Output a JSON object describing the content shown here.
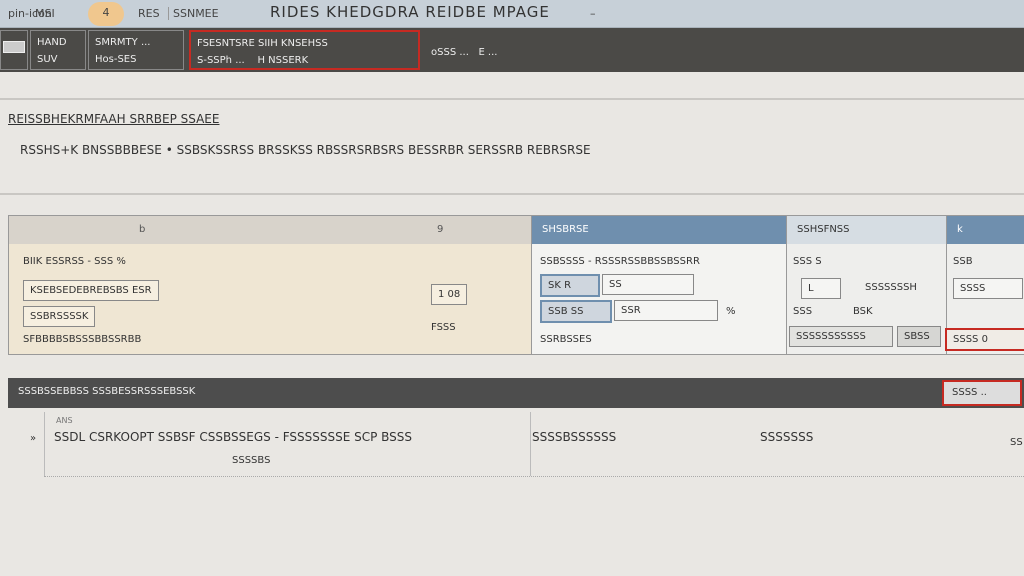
{
  "titlebar": {
    "app_icon": "pin-icon",
    "item1": "MSI",
    "item2": "4",
    "item3": "RES",
    "file": "SSNMEE",
    "title": "RIDES KHEDGDRA REIDBE MPAGE",
    "minimize": "–"
  },
  "toolbar": {
    "g1": [
      "HAND",
      "SUV"
    ],
    "g2": [
      "SMRMTY ...",
      "Hos-SES"
    ],
    "g3": [
      "FSESNTSRE SIIH KNSEHSS",
      "S-SSPh ...",
      "H NSSERK"
    ],
    "g4": [
      "oSSS ...",
      "E ..."
    ]
  },
  "intro": {
    "line1": "REISSBHEKRMFAAH SRRBEP SSAEE",
    "line2": "RSSHS+K BNSSBBBESE • SSBSKSSRSS BRSSKSS RBSSRSRBSRS BESSRBR SERSSRB REBRSRSE"
  },
  "panel": {
    "left": {
      "header_a": "b",
      "header_b": "9",
      "rows": [
        "BIIK ESSRSS - SSS %",
        "KSEBSEDEBREBSBS ESR",
        "SSBRSSSSK",
        "SFBBBBSBSSSBBSSRBB"
      ],
      "value": "1 08",
      "note": "FSSS"
    },
    "mid": {
      "header": "SHSBRSE",
      "row1": "SSBSSSS - RSSSRSSBBSSBSSRR",
      "f1_label": "SK R",
      "f1_value": "SS",
      "f2_label": "SSB SS",
      "f2_value": "SSR",
      "f2_unit": "%",
      "footer": "SSRBSSES"
    },
    "right1": {
      "header": "SSHSFNSS",
      "row1": "SSS S",
      "field": "L",
      "field_note": "SSSSSSSH",
      "row3": "SSS",
      "row3b": "BSK",
      "btn1": "SSSSSSSSSSS",
      "btn2": "SBSS"
    },
    "right2": {
      "header": "k",
      "row1": "SSB",
      "field": "SSSS",
      "btn": "SSSS 0"
    }
  },
  "bar": {
    "label": "SSSBSSEBBSS SSSBESSRSSSEBSSK",
    "button": "SSSS .."
  },
  "list": {
    "small": "ANS",
    "bullet": "»",
    "rows": [
      {
        "a": "SSDL CSRKOOPT SSBSF CSSBSSEGS - FSSSSSSSE SCP BSSS",
        "sub": "SSSSBS",
        "b": "SSSSBSSSSSS",
        "c": "SSSSSSS"
      }
    ],
    "tail": "SS"
  },
  "colors": {
    "accent_red": "#c62a22",
    "header_blue": "#6f8fae",
    "toolbar": "#4b4a47"
  }
}
